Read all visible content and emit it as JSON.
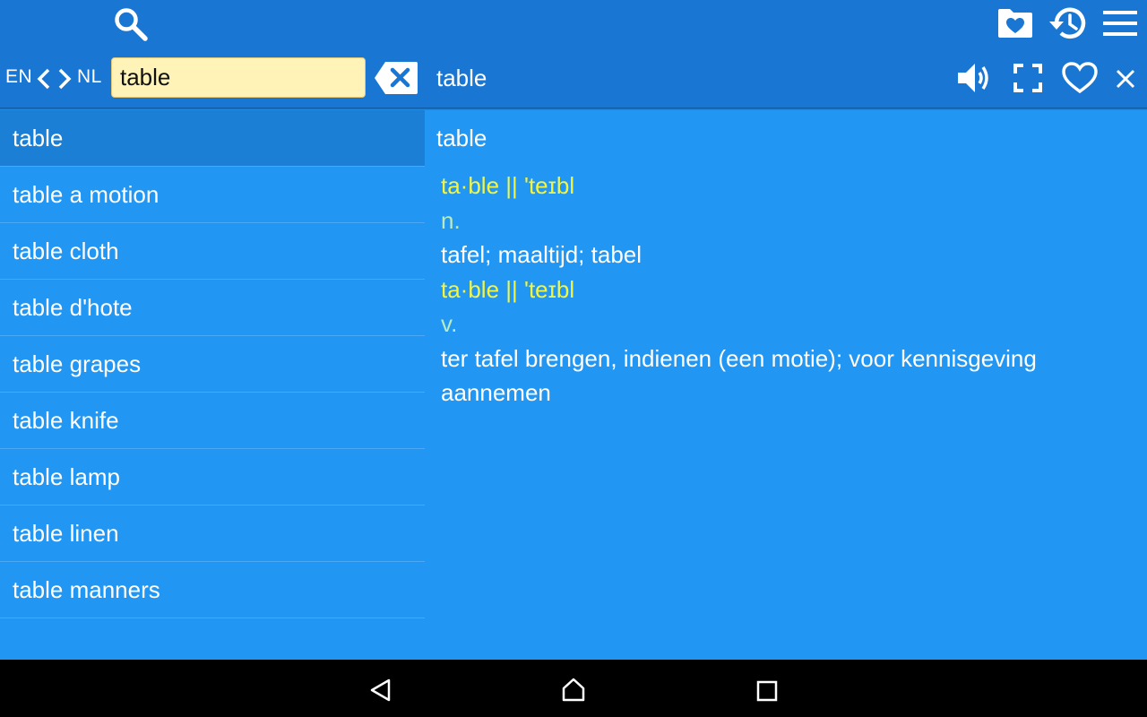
{
  "header": {
    "source_lang": "EN",
    "target_lang": "NL",
    "search_value": "table",
    "current_word": "table",
    "icons": [
      "search-icon",
      "favorites-folder-icon",
      "history-icon",
      "menu-icon",
      "swap-left-icon",
      "swap-right-icon",
      "clear-icon",
      "speaker-icon",
      "fullscreen-icon",
      "heart-icon",
      "close-icon"
    ]
  },
  "word_list": [
    {
      "label": "table",
      "selected": true
    },
    {
      "label": "table a motion"
    },
    {
      "label": "table cloth"
    },
    {
      "label": "table d'hote"
    },
    {
      "label": "table grapes"
    },
    {
      "label": "table knife"
    },
    {
      "label": "table lamp"
    },
    {
      "label": "table linen"
    },
    {
      "label": "table manners"
    }
  ],
  "detail": {
    "title": "table",
    "entries": [
      {
        "headword": "ta·ble || 'teɪbl",
        "pos": "n.",
        "translation": "tafel; maaltijd; tabel"
      },
      {
        "headword": "ta·ble || 'teɪbl",
        "pos": "v.",
        "translation": "ter tafel brengen, indienen (een motie); voor kennisgeving aannemen"
      }
    ]
  },
  "colors": {
    "topbar": "#1976d2",
    "content": "#2196f3",
    "selected_row": "#1a7fd5",
    "search_field": "#fff3b8",
    "headword": "#f4f542",
    "part_of_speech": "#b8ecc0",
    "navbar": "#000000"
  },
  "system_nav": {
    "icons": [
      "back-icon",
      "home-icon",
      "recents-icon"
    ]
  }
}
